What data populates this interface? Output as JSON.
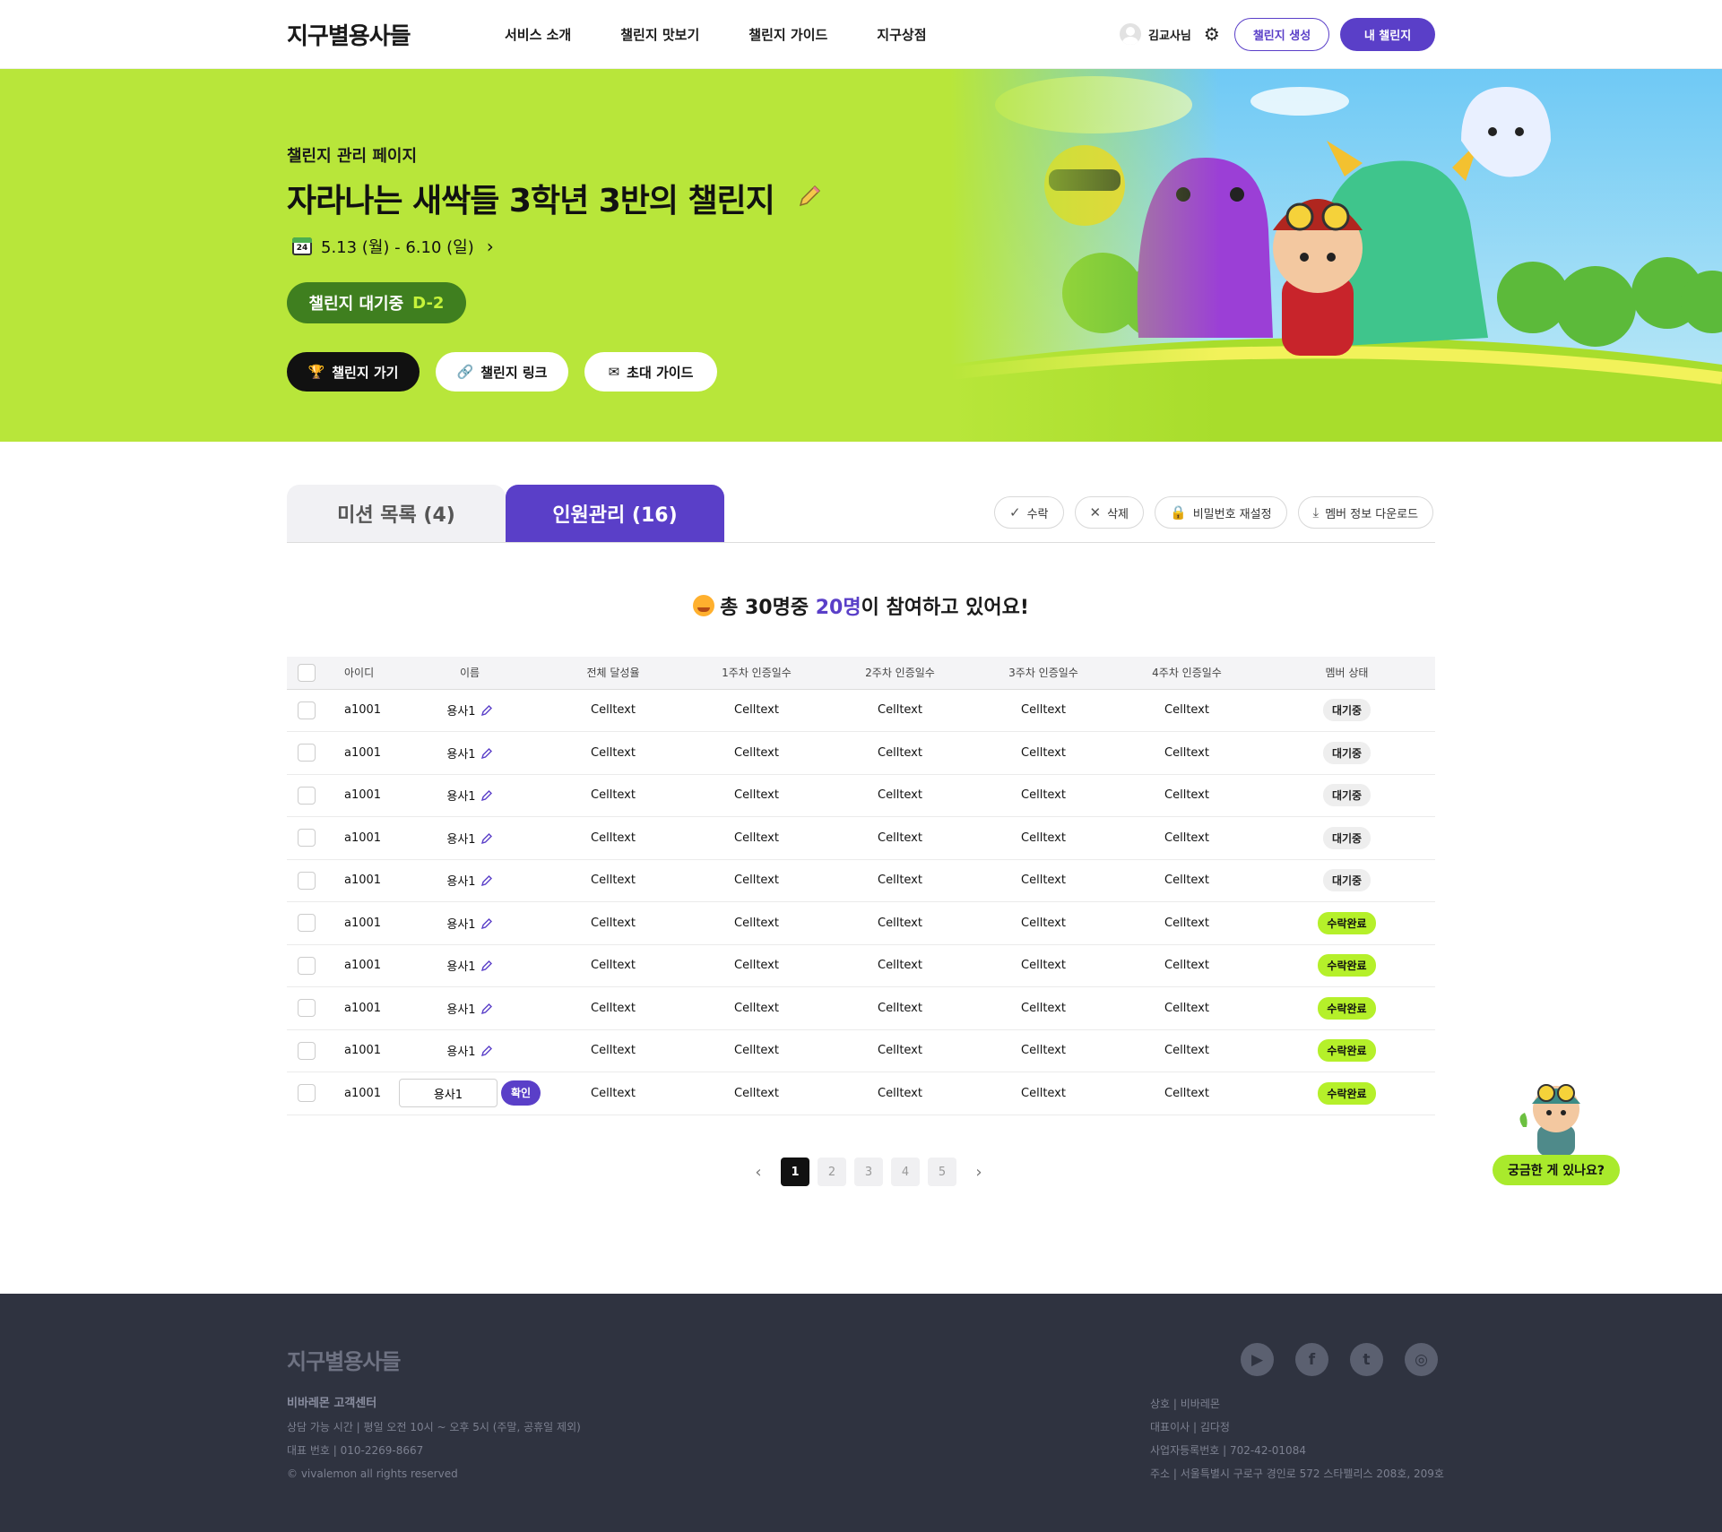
{
  "header": {
    "logo": "지구별용사들",
    "nav": [
      "서비스 소개",
      "챌린지 맛보기",
      "챌린지 가이드",
      "지구상점"
    ],
    "user_name": "김교사님",
    "create_btn": "챌린지 생성",
    "my_btn": "내 챌린지"
  },
  "hero": {
    "subtitle": "챌린지 관리 페이지",
    "title": "자라나는 새싹들 3학년 3반의 챌린지",
    "calendar_day": "24",
    "date_range": "5.13 (월) - 6.10 (일)",
    "status": "챌린지 대기중",
    "dday": "D-2",
    "buttons": {
      "go": "챌린지 가기",
      "link": "챌린지 링크",
      "invite": "초대 가이드"
    }
  },
  "tabs": [
    {
      "label": "미션 목록 (4)",
      "active": false
    },
    {
      "label": "인원관리 (16)",
      "active": true
    }
  ],
  "actions": {
    "accept": "수락",
    "delete": "삭제",
    "reset_pw": "비밀번호 재설정",
    "download": "멤버 정보 다운로드"
  },
  "summary": {
    "prefix": "총 30명중 ",
    "highlight": "20명",
    "suffix": "이 참여하고 있어요!"
  },
  "table": {
    "headers": [
      "아이디",
      "이름",
      "전체 달성율",
      "1주차 인증일수",
      "2주차 인증일수",
      "3주차 인증일수",
      "4주차 인증일수",
      "멤버 상태"
    ],
    "rows": [
      {
        "id": "a1001",
        "name": "용사1",
        "c1": "Celltext",
        "c2": "Celltext",
        "c3": "Celltext",
        "c4": "Celltext",
        "c5": "Celltext",
        "status": "대기중"
      },
      {
        "id": "a1001",
        "name": "용사1",
        "c1": "Celltext",
        "c2": "Celltext",
        "c3": "Celltext",
        "c4": "Celltext",
        "c5": "Celltext",
        "status": "대기중"
      },
      {
        "id": "a1001",
        "name": "용사1",
        "c1": "Celltext",
        "c2": "Celltext",
        "c3": "Celltext",
        "c4": "Celltext",
        "c5": "Celltext",
        "status": "대기중"
      },
      {
        "id": "a1001",
        "name": "용사1",
        "c1": "Celltext",
        "c2": "Celltext",
        "c3": "Celltext",
        "c4": "Celltext",
        "c5": "Celltext",
        "status": "대기중"
      },
      {
        "id": "a1001",
        "name": "용사1",
        "c1": "Celltext",
        "c2": "Celltext",
        "c3": "Celltext",
        "c4": "Celltext",
        "c5": "Celltext",
        "status": "대기중"
      },
      {
        "id": "a1001",
        "name": "용사1",
        "c1": "Celltext",
        "c2": "Celltext",
        "c3": "Celltext",
        "c4": "Celltext",
        "c5": "Celltext",
        "status": "수락완료"
      },
      {
        "id": "a1001",
        "name": "용사1",
        "c1": "Celltext",
        "c2": "Celltext",
        "c3": "Celltext",
        "c4": "Celltext",
        "c5": "Celltext",
        "status": "수락완료"
      },
      {
        "id": "a1001",
        "name": "용사1",
        "c1": "Celltext",
        "c2": "Celltext",
        "c3": "Celltext",
        "c4": "Celltext",
        "c5": "Celltext",
        "status": "수락완료"
      },
      {
        "id": "a1001",
        "name": "용사1",
        "c1": "Celltext",
        "c2": "Celltext",
        "c3": "Celltext",
        "c4": "Celltext",
        "c5": "Celltext",
        "status": "수락완료"
      }
    ],
    "edit_row": {
      "id": "a1001",
      "name_value": "용사1",
      "confirm": "확인",
      "c1": "Celltext",
      "c2": "Celltext",
      "c3": "Celltext",
      "c4": "Celltext",
      "c5": "Celltext",
      "status": "수락완료"
    }
  },
  "pagination": {
    "pages": [
      "1",
      "2",
      "3",
      "4",
      "5"
    ],
    "current": "1",
    "prev": "‹",
    "next": "›"
  },
  "help": {
    "label": "궁금한 게 있나요?"
  },
  "footer": {
    "logo": "지구별용사들",
    "center_title": "비바레몬 고객센터",
    "hours": "상담 가능 시간 | 평일 오전 10시 ~ 오후 5시 (주말, 공휴일 제외)",
    "phone": "대표 번호 | 010-2269-8667",
    "copyright": "© vivalemon all rights reserved",
    "company": "상호 | 비바레몬",
    "ceo": "대표이사 | 김다정",
    "biz_no": "사업자등록번호 | 702-42-01084",
    "address": "주소 | 서울특별시 구로구 경인로 572 스타펠리스 208호, 209호",
    "socials": [
      "youtube-icon",
      "facebook-icon",
      "twitter-icon",
      "instagram-icon"
    ]
  }
}
